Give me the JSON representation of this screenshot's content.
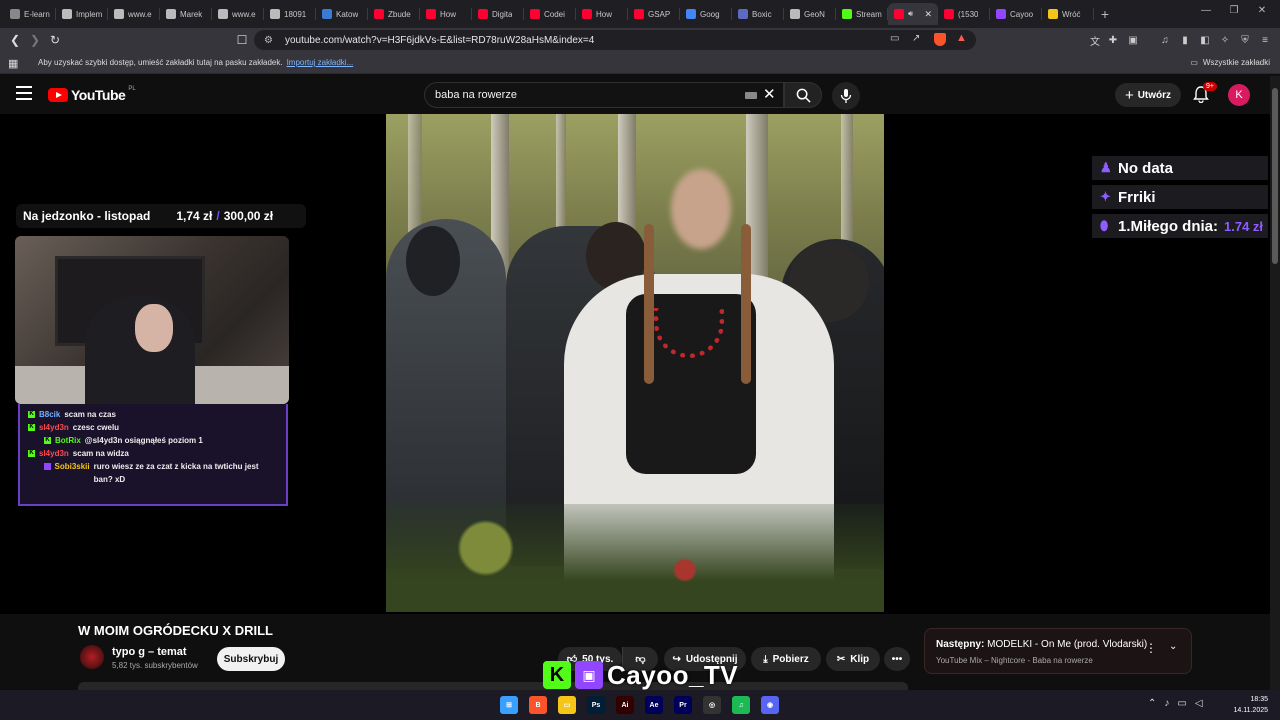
{
  "browser": {
    "tabs": [
      {
        "title": "E-learni",
        "color": "#888"
      },
      {
        "title": "Implem",
        "color": "#bbb"
      },
      {
        "title": "www.e",
        "color": "#bbb"
      },
      {
        "title": "Marek",
        "color": "#bbb"
      },
      {
        "title": "www.e",
        "color": "#bbb"
      },
      {
        "title": "18091",
        "color": "#bbb"
      },
      {
        "title": "Katow",
        "color": "#3a7bd5"
      },
      {
        "title": "Zbude",
        "color": "#ff0033"
      },
      {
        "title": "How",
        "color": "#ff0033"
      },
      {
        "title": "Digita",
        "color": "#ff0033"
      },
      {
        "title": "Codei",
        "color": "#ff0033"
      },
      {
        "title": "How",
        "color": "#ff0033"
      },
      {
        "title": "GSAP",
        "color": "#ff0033"
      },
      {
        "title": "Goog",
        "color": "#4285f4"
      },
      {
        "title": "Boxic",
        "color": "#5c6bc0"
      },
      {
        "title": "GeoN",
        "color": "#bbb"
      },
      {
        "title": "Stream",
        "color": "#53fc18"
      },
      {
        "title": "",
        "color": "#ff0033",
        "active": true
      },
      {
        "title": "(1530",
        "color": "#ff0033"
      },
      {
        "title": "Cayoo",
        "color": "#9146ff"
      },
      {
        "title": "Wróć",
        "color": "#f5c518"
      }
    ],
    "url": "youtube.com/watch?v=H3F6jdkVs-E&list=RD78ruW28aHsM&index=4",
    "bookmarks_hint": "Aby uzyskać szybki dostęp, umieść zakładki tutaj na pasku zakładek.",
    "bookmarks_import": "Importuj zakładki...",
    "all_bookmarks": "Wszystkie zakładki"
  },
  "youtube": {
    "logo_text": "YouTube",
    "country": "PL",
    "search_value": "baba na rowerze",
    "create_label": "Utwórz",
    "notif_badge": "9+",
    "avatar_letter": "K"
  },
  "overlay": {
    "goal_title": "Na jedzonko - listopad",
    "goal_current": "1,74 zł",
    "goal_sep": "/",
    "goal_target": "300,00 zł",
    "chat": [
      {
        "user": "B8cik",
        "text": "scam na czas",
        "color": "#6fb3ff",
        "kick": true
      },
      {
        "user": "sl4yd3n",
        "text": "czesc cwelu",
        "color": "#ff4b4b",
        "kick": true
      },
      {
        "user": "BotRix",
        "text": "@sl4yd3n osiągnąłeś poziom 1",
        "color": "#53fc18",
        "kick": true,
        "indent": true
      },
      {
        "user": "sl4yd3n",
        "text": "scam na widza",
        "color": "#ff4b4b",
        "kick": true
      },
      {
        "user": "Sobi3skii",
        "text": "ruro wiesz ze za czat z kicka na twtichu jest ban? xD",
        "color": "#f5c518",
        "kick": false,
        "indent": true
      }
    ],
    "right_panel": [
      {
        "icon": "♟",
        "label": "No data",
        "value": ""
      },
      {
        "icon": "✦",
        "label": "Frriki",
        "value": ""
      },
      {
        "icon": "⬮",
        "label": "1.Miłego dnia:",
        "value": "1.74 zł"
      }
    ],
    "brand_name": "Cayoo_TV"
  },
  "video": {
    "title": "W MOIM OGRÓDECKU X DRILL",
    "channel": "typo g – temat",
    "subscribers": "5,82 tys. subskrybentów",
    "subscribe_label": "Subskrybuj",
    "likes": "50 tys.",
    "share_label": "Udostępnij",
    "download_label": "Pobierz",
    "clip_label": "Klip",
    "upnext_prefix": "Następny:",
    "upnext_title": "MODELKI - On Me (prod. Vlodarski)",
    "upnext_sub": "YouTube Mix – Nightcore - Baba na rowerze"
  },
  "taskbar": {
    "time": "18:35",
    "date": "14.11.2025",
    "apps": [
      {
        "name": "windows-start",
        "label": "⊞",
        "color": "#3aa0ff"
      },
      {
        "name": "brave-browser",
        "label": "B",
        "color": "#fb542b"
      },
      {
        "name": "file-explorer",
        "label": "▭",
        "color": "#f5c518"
      },
      {
        "name": "photoshop",
        "label": "Ps",
        "color": "#001e36"
      },
      {
        "name": "illustrator",
        "label": "Ai",
        "color": "#330000"
      },
      {
        "name": "after-effects",
        "label": "Ae",
        "color": "#00005b"
      },
      {
        "name": "premiere",
        "label": "Pr",
        "color": "#00005b"
      },
      {
        "name": "obs",
        "label": "◎",
        "color": "#333"
      },
      {
        "name": "spotify",
        "label": "♫",
        "color": "#1db954"
      },
      {
        "name": "discord",
        "label": "◉",
        "color": "#5865f2"
      }
    ]
  }
}
